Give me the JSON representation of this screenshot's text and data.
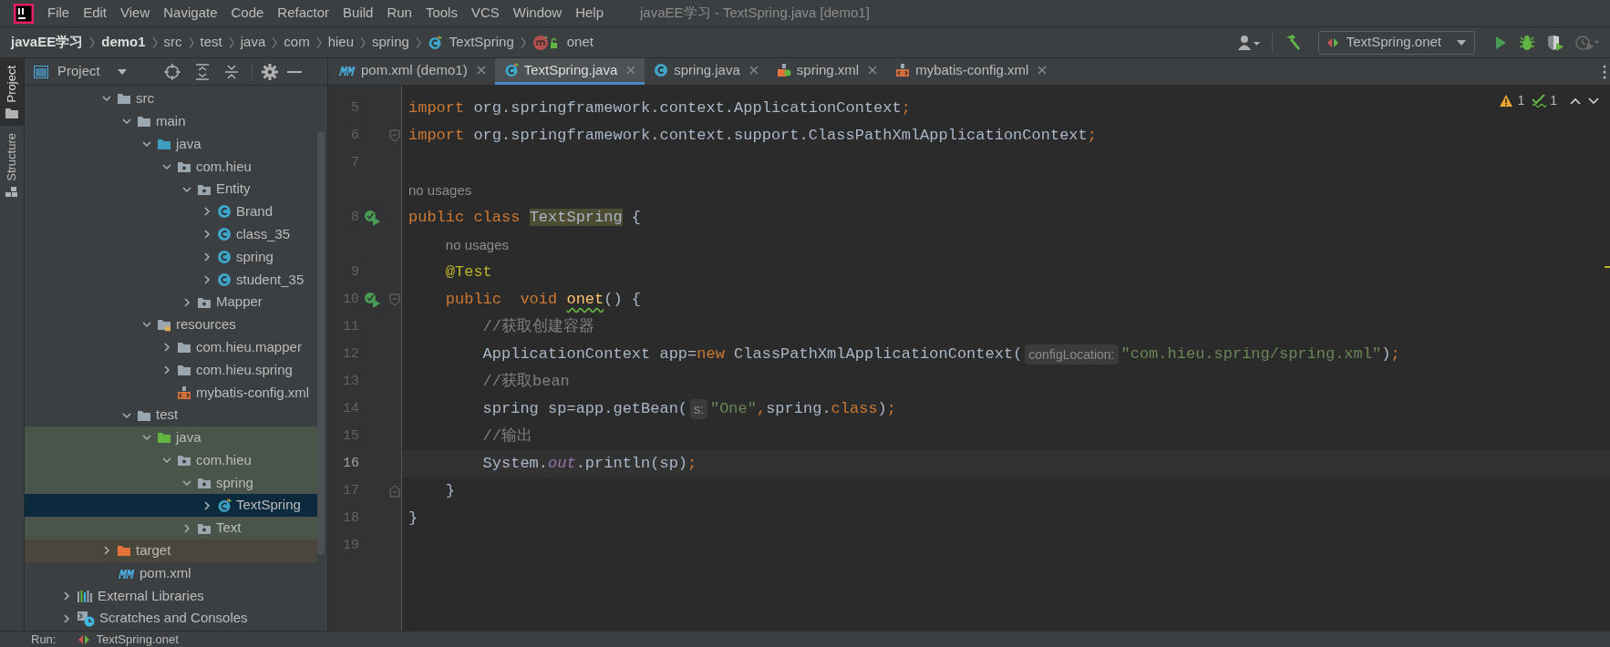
{
  "window": {
    "title": "javaEE学习 - TextSpring.java [demo1]"
  },
  "menu": [
    "File",
    "Edit",
    "View",
    "Navigate",
    "Code",
    "Refactor",
    "Build",
    "Run",
    "Tools",
    "VCS",
    "Window",
    "Help"
  ],
  "breadcrumb": [
    {
      "label": "javaEE学习",
      "kind": "project"
    },
    {
      "label": "demo1",
      "kind": "module"
    },
    {
      "label": "src",
      "kind": "folder"
    },
    {
      "label": "test",
      "kind": "folder"
    },
    {
      "label": "java",
      "kind": "folder"
    },
    {
      "label": "com",
      "kind": "folder"
    },
    {
      "label": "hieu",
      "kind": "folder"
    },
    {
      "label": "spring",
      "kind": "folder"
    },
    {
      "label": "TextSpring",
      "kind": "class"
    },
    {
      "label": "onet",
      "kind": "method"
    }
  ],
  "toolbar": {
    "run_config": "TextSpring.onet"
  },
  "side_tabs": [
    {
      "label": "Project",
      "selected": true
    },
    {
      "label": "Structure",
      "selected": false
    }
  ],
  "project": {
    "title": "Project",
    "module_children": [
      {
        "label": "src",
        "kind": "folder",
        "expanded": true,
        "selected": false,
        "children": [
          {
            "label": "main",
            "kind": "folder",
            "expanded": true,
            "selected": false,
            "children": [
              {
                "label": "java",
                "kind": "source-folder",
                "expanded": true,
                "selected": false,
                "children": [
                  {
                    "label": "com.hieu",
                    "kind": "package",
                    "expanded": true,
                    "selected": false,
                    "children": [
                      {
                        "label": "Entity",
                        "kind": "package",
                        "expanded": true,
                        "selected": false,
                        "children": [
                          {
                            "label": "Brand",
                            "kind": "class",
                            "expanded": false,
                            "selected": false
                          },
                          {
                            "label": "class_35",
                            "kind": "class",
                            "expanded": false,
                            "selected": false
                          },
                          {
                            "label": "spring",
                            "kind": "class",
                            "expanded": false,
                            "selected": false
                          },
                          {
                            "label": "student_35",
                            "kind": "class",
                            "expanded": false,
                            "selected": false
                          }
                        ]
                      },
                      {
                        "label": "Mapper",
                        "kind": "package",
                        "expanded": false,
                        "selected": false
                      }
                    ]
                  }
                ]
              },
              {
                "label": "resources",
                "kind": "resources",
                "expanded": true,
                "selected": false,
                "children": [
                  {
                    "label": "com.hieu.mapper",
                    "kind": "folder",
                    "expanded": false,
                    "selected": false
                  },
                  {
                    "label": "com.hieu.spring",
                    "kind": "folder",
                    "expanded": false,
                    "selected": false
                  },
                  {
                    "label": "mybatis-config.xml",
                    "kind": "xml",
                    "selected": false
                  }
                ]
              }
            ]
          },
          {
            "label": "test",
            "kind": "folder",
            "expanded": true,
            "selected": false,
            "children": [
              {
                "label": "java",
                "kind": "test-folder",
                "test_scope": true,
                "expanded": true,
                "selected": false,
                "children": [
                  {
                    "label": "com.hieu",
                    "kind": "package",
                    "test_scope": true,
                    "expanded": true,
                    "selected": false,
                    "children": [
                      {
                        "label": "spring",
                        "kind": "package",
                        "test_scope": true,
                        "expanded": true,
                        "selected": false,
                        "children": [
                          {
                            "label": "TextSpring",
                            "kind": "test-class",
                            "test_scope": true,
                            "expanded": false,
                            "selected": true
                          }
                        ]
                      },
                      {
                        "label": "Text",
                        "kind": "package",
                        "test_scope": true,
                        "expanded": false,
                        "selected": false
                      }
                    ]
                  }
                ]
              }
            ]
          }
        ]
      },
      {
        "label": "target",
        "kind": "excluded-folder",
        "excluded": true,
        "expanded": false,
        "selected": false
      },
      {
        "label": "pom.xml",
        "kind": "maven",
        "selected": false
      }
    ],
    "roots": [
      {
        "label": "External Libraries",
        "kind": "libraries",
        "expanded": false,
        "selected": false
      },
      {
        "label": "Scratches and Consoles",
        "kind": "scratches",
        "expanded": false,
        "selected": false
      }
    ]
  },
  "tabs": [
    {
      "label": "pom.xml (demo1)",
      "kind": "maven",
      "selected": false
    },
    {
      "label": "TextSpring.java",
      "kind": "test-class",
      "selected": true
    },
    {
      "label": "spring.java",
      "kind": "class",
      "selected": false
    },
    {
      "label": "spring.xml",
      "kind": "spring-xml",
      "selected": false
    },
    {
      "label": "mybatis-config.xml",
      "kind": "xml",
      "selected": false
    }
  ],
  "inspections": {
    "warnings": "1",
    "weak_warnings": "1"
  },
  "code": [
    {
      "number": "5",
      "current": false,
      "tokens": [
        {
          "text": "import ",
          "kind": "keyword"
        },
        {
          "text": "org.springframework.context.ApplicationContext",
          "kind": "plain"
        },
        {
          "text": ";",
          "kind": "keyword"
        }
      ]
    },
    {
      "number": "6",
      "current": false,
      "fold_start": true,
      "tokens": [
        {
          "text": "import ",
          "kind": "keyword"
        },
        {
          "text": "org.springframework.context.support.ClassPathXmlApplicationContext",
          "kind": "plain"
        },
        {
          "text": ";",
          "kind": "keyword"
        }
      ]
    },
    {
      "number": "7",
      "current": false
    },
    {
      "tokens": [
        {
          "text": "no usages",
          "kind": "usage"
        }
      ]
    },
    {
      "number": "8",
      "current": false,
      "run_marker": true,
      "tokens": [
        {
          "text": "public class ",
          "kind": "keyword"
        },
        {
          "text": "TextSpring",
          "kind": "highlight"
        },
        {
          "text": " {",
          "kind": "plain"
        }
      ]
    },
    {
      "tokens": [
        {
          "text": "no usages",
          "kind": "usage"
        }
      ]
    },
    {
      "number": "9",
      "current": false,
      "tokens": [
        {
          "text": "    @Test",
          "kind": "annotation"
        }
      ]
    },
    {
      "number": "10",
      "current": false,
      "run_marker": true,
      "fold_start": true,
      "tokens": [
        {
          "text": "    public  void ",
          "kind": "keyword"
        },
        {
          "text": "onet",
          "kind": "method"
        },
        {
          "text": "() {",
          "kind": "plain"
        }
      ]
    },
    {
      "number": "11",
      "current": false,
      "tokens": [
        {
          "text": "        //获取创建容器",
          "kind": "comment"
        }
      ]
    },
    {
      "number": "12",
      "current": false,
      "tokens": [
        {
          "text": "        ApplicationContext app=",
          "kind": "plain"
        },
        {
          "text": "new",
          "kind": "keyword"
        },
        {
          "text": " ClassPathXmlApplicationContext(",
          "kind": "plain"
        },
        {
          "text": "configLocation:",
          "kind": "hint"
        },
        {
          "text": "\"com.hieu.spring/spring.xml\"",
          "kind": "string"
        },
        {
          "text": ")",
          "kind": "plain"
        },
        {
          "text": ";",
          "kind": "keyword"
        }
      ]
    },
    {
      "number": "13",
      "current": false,
      "tokens": [
        {
          "text": "        //获取bean",
          "kind": "comment"
        }
      ]
    },
    {
      "number": "14",
      "current": false,
      "tokens": [
        {
          "text": "        spring sp=app.getBean(",
          "kind": "plain"
        },
        {
          "text": "s:",
          "kind": "hint"
        },
        {
          "text": "\"One\"",
          "kind": "string"
        },
        {
          "text": ",",
          "kind": "keyword"
        },
        {
          "text": "spring.",
          "kind": "plain"
        },
        {
          "text": "class",
          "kind": "keyword"
        },
        {
          "text": ")",
          "kind": "plain"
        },
        {
          "text": ";",
          "kind": "keyword"
        }
      ]
    },
    {
      "number": "15",
      "current": false,
      "tokens": [
        {
          "text": "        //输出",
          "kind": "comment"
        }
      ]
    },
    {
      "number": "16",
      "current": true,
      "tokens": [
        {
          "text": "        System.",
          "kind": "plain"
        },
        {
          "text": "out",
          "kind": "static"
        },
        {
          "text": ".println(sp)",
          "kind": "plain"
        },
        {
          "text": ";",
          "kind": "keyword"
        }
      ]
    },
    {
      "number": "17",
      "current": false,
      "fold_end": true,
      "tokens": [
        {
          "text": "    }",
          "kind": "plain"
        }
      ]
    },
    {
      "number": "18",
      "current": false,
      "tokens": [
        {
          "text": "}",
          "kind": "plain"
        }
      ]
    },
    {
      "number": "19",
      "current": false
    }
  ],
  "run_bar": {
    "label": "Run:",
    "config": "TextSpring.onet"
  }
}
